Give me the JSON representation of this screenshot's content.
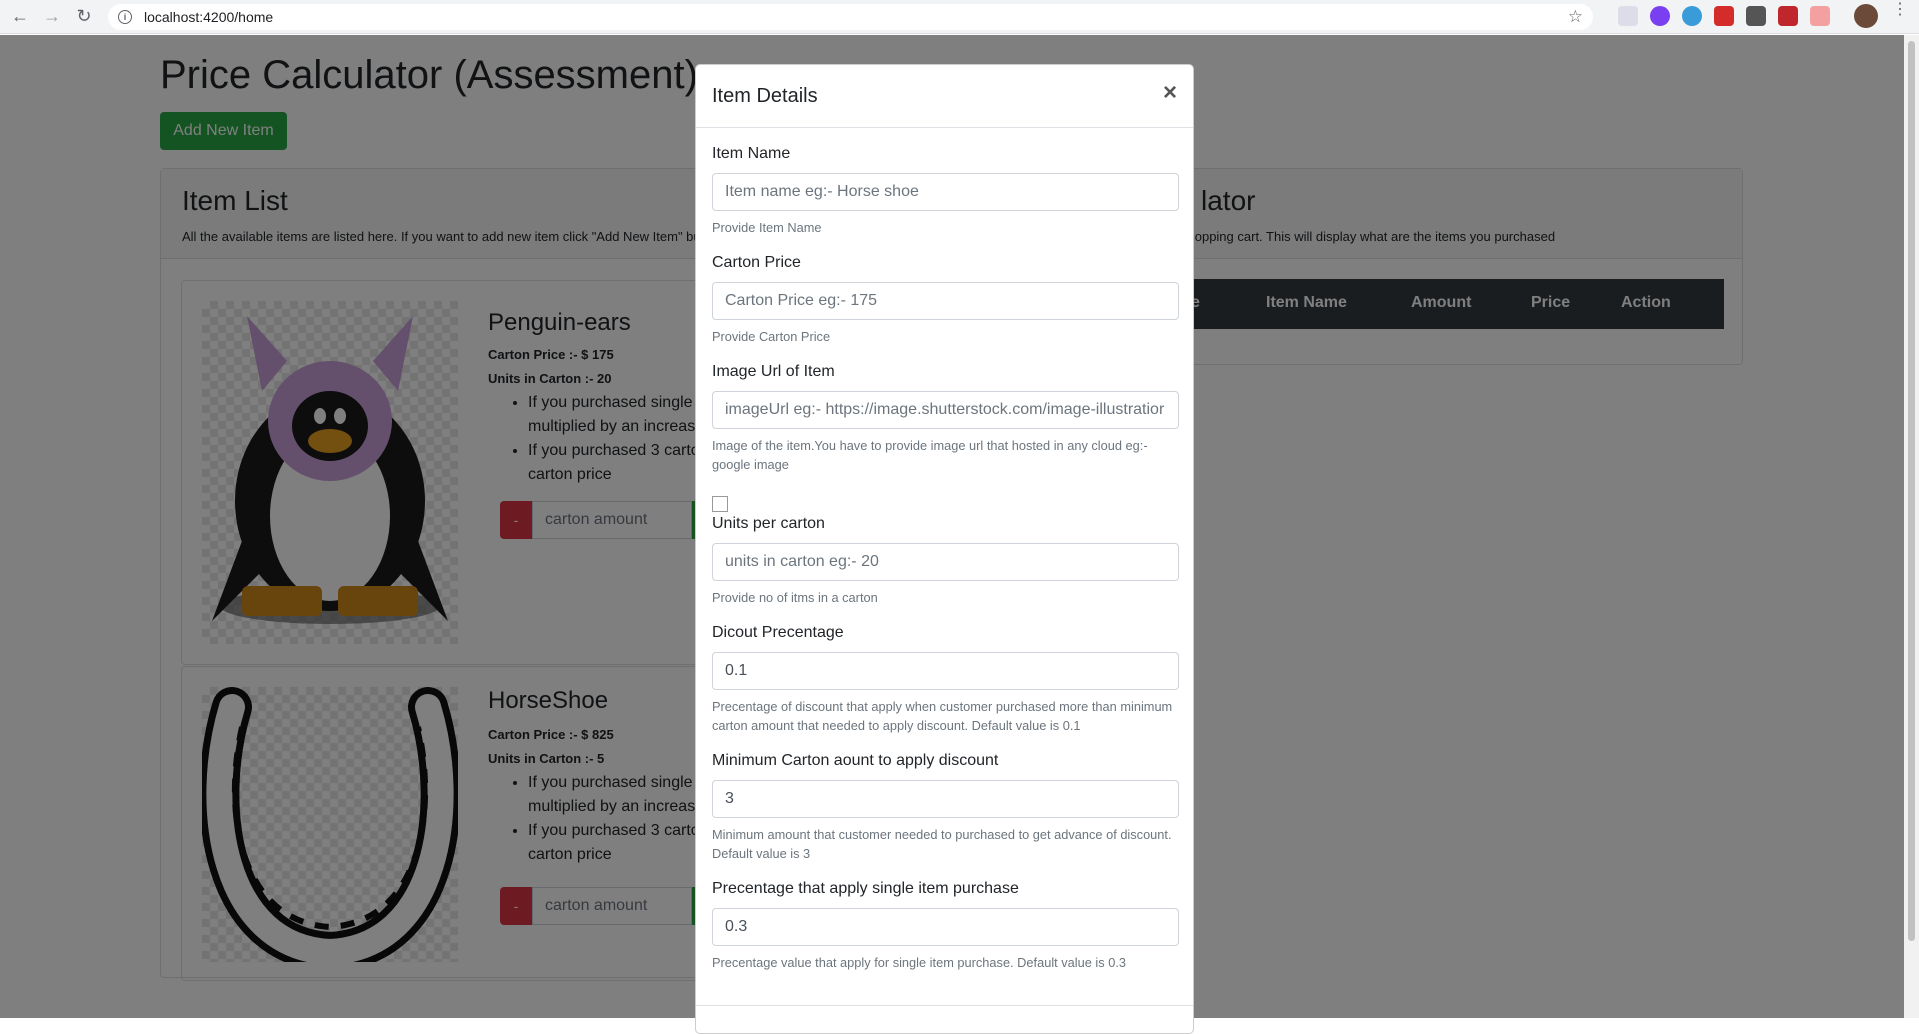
{
  "browser": {
    "url": "localhost:4200/home"
  },
  "page": {
    "title": "Price Calculator (Assessment)",
    "add_button": "Add New Item",
    "item_list": {
      "heading": "Item List",
      "description": "All the available items are listed here. If you want to add new item click \"Add New Item\" but"
    },
    "items": [
      {
        "name": "Penguin-ears",
        "carton_price": "Carton Price :- $ 175",
        "units": "Units in Carton :- 20",
        "bullet1": "If you purchased single multiplied by an increas",
        "bullet2": "If you purchased 3 carto the carton price",
        "qty_placeholder": "carton amount",
        "minus": "-"
      },
      {
        "name": "HorseShoe",
        "carton_price": "Carton Price :- $ 825",
        "units": "Units in Carton :- 5",
        "bullet1": "If you purchased single multiplied by an increas",
        "bullet2": "If you purchased 3 carto the carton price",
        "qty_placeholder": "carton amount",
        "minus": "-"
      }
    ],
    "calculator": {
      "heading": "lator",
      "description": "shopping cart. This will display what are the items you purchased",
      "columns": [
        "e",
        "Item Name",
        "Amount",
        "Price",
        "Action"
      ]
    }
  },
  "modal": {
    "title": "Item Details",
    "close": "×",
    "fields": {
      "item_name": {
        "label": "Item Name",
        "placeholder": "Item name eg:- Horse shoe",
        "help": "Provide Item Name"
      },
      "carton_price": {
        "label": "Carton Price",
        "placeholder": "Carton Price eg:- 175",
        "help": "Provide Carton Price"
      },
      "image_url": {
        "label": "Image Url of Item",
        "placeholder": "imageUrl eg:- https://image.shutterstock.com/image-illustratior",
        "help": "Image of the item.You have to provide image url that hosted in any cloud eg:- google image"
      },
      "units": {
        "label": "Units per carton",
        "placeholder": "units in carton eg:- 20",
        "help": "Provide no of itms in a carton"
      },
      "discount": {
        "label": "Dicout Precentage",
        "value": "0.1",
        "help": "Precentage of discount that apply when customer purchased more than minimum carton amount that needed to apply discount. Default value is 0.1"
      },
      "min_carton": {
        "label": "Minimum Carton aount to apply discount",
        "value": "3",
        "help": "Minimum amount that customer needed to purchased to get advance of discount. Default value is 3"
      },
      "single_pct": {
        "label": "Precentage that apply single item purchase",
        "value": "0.3",
        "help": "Precentage value that apply for single item purchase. Default value is 0.3"
      }
    }
  },
  "colors": {
    "success": "#28a745",
    "danger": "#dc3545",
    "dark": "#343a40"
  }
}
